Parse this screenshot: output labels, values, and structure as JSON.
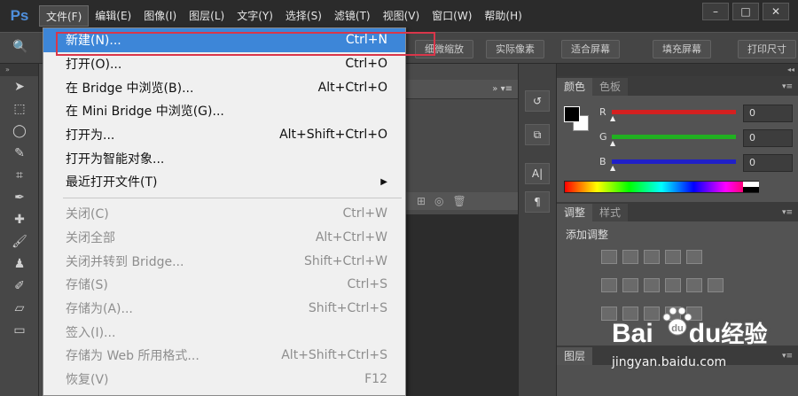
{
  "app": {
    "logo": "Ps"
  },
  "menubar": {
    "items": [
      {
        "label": "文件(F)",
        "active": true
      },
      {
        "label": "编辑(E)"
      },
      {
        "label": "图像(I)"
      },
      {
        "label": "图层(L)"
      },
      {
        "label": "文字(Y)"
      },
      {
        "label": "选择(S)"
      },
      {
        "label": "滤镜(T)"
      },
      {
        "label": "视图(V)"
      },
      {
        "label": "窗口(W)"
      },
      {
        "label": "帮助(H)"
      }
    ],
    "window_buttons": [
      "–",
      "□",
      "✕"
    ]
  },
  "options_bar": {
    "buttons": [
      "细微缩放",
      "实际像素",
      "适合屏幕",
      "填充屏幕",
      "打印尺寸"
    ]
  },
  "file_menu": {
    "items": [
      {
        "label": "新建(N)...",
        "shortcut": "Ctrl+N",
        "highlight": true
      },
      {
        "label": "打开(O)...",
        "shortcut": "Ctrl+O"
      },
      {
        "label": "在 Bridge 中浏览(B)...",
        "shortcut": "Alt+Ctrl+O"
      },
      {
        "label": "在 Mini Bridge 中浏览(G)...",
        "shortcut": ""
      },
      {
        "label": "打开为...",
        "shortcut": "Alt+Shift+Ctrl+O"
      },
      {
        "label": "打开为智能对象...",
        "shortcut": ""
      },
      {
        "label": "最近打开文件(T)",
        "shortcut": "",
        "submenu": true
      },
      {
        "separator": true
      },
      {
        "label": "关闭(C)",
        "shortcut": "Ctrl+W",
        "disabled": true
      },
      {
        "label": "关闭全部",
        "shortcut": "Alt+Ctrl+W",
        "disabled": true
      },
      {
        "label": "关闭并转到 Bridge...",
        "shortcut": "Shift+Ctrl+W",
        "disabled": true
      },
      {
        "label": "存储(S)",
        "shortcut": "Ctrl+S",
        "disabled": true
      },
      {
        "label": "存储为(A)...",
        "shortcut": "Shift+Ctrl+S",
        "disabled": true
      },
      {
        "label": "签入(I)...",
        "shortcut": "",
        "disabled": true
      },
      {
        "label": "存储为 Web 所用格式...",
        "shortcut": "Alt+Shift+Ctrl+S",
        "disabled": true
      },
      {
        "label": "恢复(V)",
        "shortcut": "F12",
        "disabled": true
      }
    ]
  },
  "color_panel": {
    "tabs": [
      "颜色",
      "色板"
    ],
    "channels": [
      {
        "name": "R",
        "value": "0",
        "color": "#d42020"
      },
      {
        "name": "G",
        "value": "0",
        "color": "#20b020"
      },
      {
        "name": "B",
        "value": "0",
        "color": "#2020c8"
      }
    ]
  },
  "adjust_panel": {
    "tabs": [
      "调整",
      "样式"
    ],
    "title": "添加调整"
  },
  "layers_panel": {
    "tabs": [
      "图层"
    ]
  },
  "watermark": {
    "main": "Bai",
    "main2": "du",
    "cn": "经验",
    "url": "jingyan.baidu.com"
  }
}
